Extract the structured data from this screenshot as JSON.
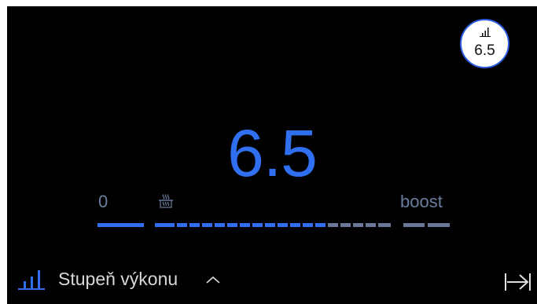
{
  "badge": {
    "icon": "power-level-icon",
    "value": "6.5"
  },
  "power": {
    "value": "6.5",
    "min_label": "0",
    "max_label": "boost",
    "marker_icon": "pot-steam-icon",
    "level_fraction": 0.62
  },
  "footer": {
    "title": "Stupeň výkonu",
    "title_icon": "power-level-icon",
    "toggle_icon": "chevron-up-icon",
    "exit_icon": "exit-arrow-icon"
  },
  "colors": {
    "accent": "#2f6ff0",
    "inactive_segment": "#6a7697",
    "label": "#6b7d9e",
    "background": "#000000"
  }
}
